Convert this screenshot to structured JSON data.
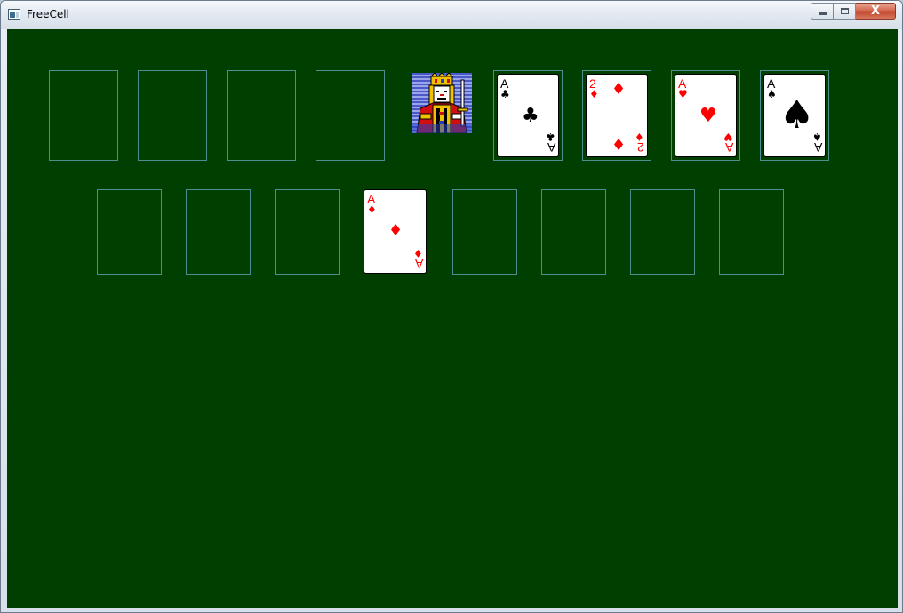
{
  "window": {
    "title": "FreeCell",
    "icon": "freecell-app-icon"
  },
  "caption_buttons": {
    "minimize": "minimize-icon",
    "maximize": "maximize-icon",
    "close": "close-icon",
    "close_glyph": "X"
  },
  "colors": {
    "table": "#003f00",
    "slot_outline": "#4d8f8f",
    "red_suit": "#ff0000",
    "black_suit": "#000000"
  },
  "free_cells": [
    {
      "card": null
    },
    {
      "card": null
    },
    {
      "card": null
    },
    {
      "card": null
    }
  ],
  "king_icon": "king-of-hearts-icon",
  "foundations": [
    {
      "rank": "A",
      "suit": "♣",
      "color": "black"
    },
    {
      "rank": "2",
      "suit": "♦",
      "color": "red"
    },
    {
      "rank": "A",
      "suit": "♥",
      "color": "red"
    },
    {
      "rank": "A",
      "suit": "♠",
      "color": "black"
    }
  ],
  "cascades": [
    {
      "cards": []
    },
    {
      "cards": []
    },
    {
      "cards": []
    },
    {
      "cards": [
        {
          "rank": "A",
          "suit": "♦",
          "color": "red"
        }
      ]
    },
    {
      "cards": []
    },
    {
      "cards": []
    },
    {
      "cards": []
    },
    {
      "cards": []
    }
  ]
}
